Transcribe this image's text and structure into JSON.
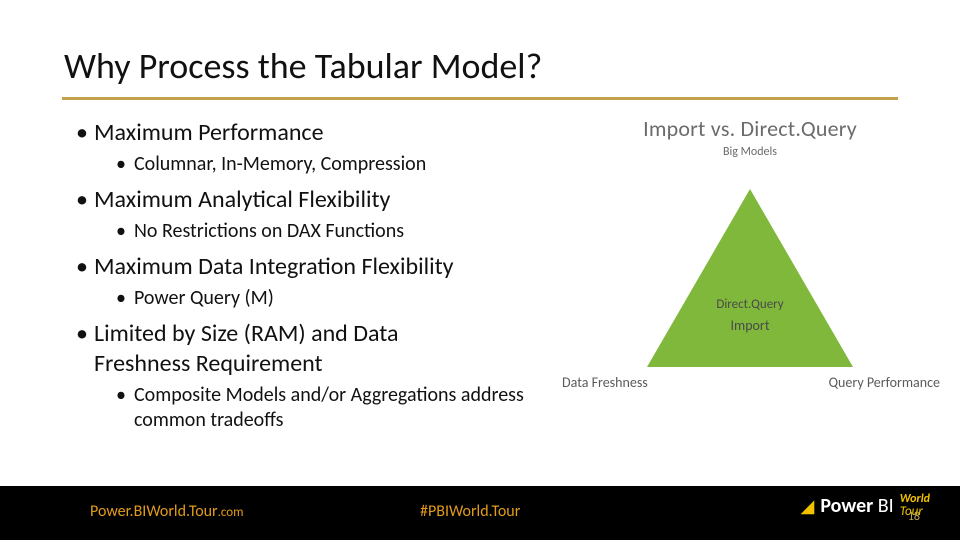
{
  "title": "Why Process the Tabular Model?",
  "bullets": [
    {
      "text": "Maximum Performance",
      "sub": [
        "Columnar, In-Memory, Compression"
      ]
    },
    {
      "text": "Maximum Analytical Flexibility",
      "sub": [
        "No Restrictions on DAX Functions"
      ]
    },
    {
      "text": "Maximum Data Integration Flexibility",
      "sub": [
        "Power Query (M)"
      ]
    },
    {
      "text": "Limited by Size (RAM) and Data Freshness Requirement",
      "sub": [
        "Composite Models and/or Aggregations address common tradeoffs"
      ]
    }
  ],
  "figure": {
    "title": "Import vs. Direct.Query",
    "subtitle": "Big Models",
    "label_top": "Big Models",
    "label_left": "Data Freshness",
    "label_right": "Query Performance",
    "label_inside_1": "Direct.Query",
    "label_inside_2": "Import"
  },
  "footer": {
    "left_main": "Power.BIWorld.Tour",
    "left_suffix": ".com",
    "mid": "#PBIWorld.Tour",
    "logo_power": "Power",
    "logo_bi": " BI",
    "logo_world": "World",
    "logo_tour": "Tour"
  },
  "page_number": "18"
}
